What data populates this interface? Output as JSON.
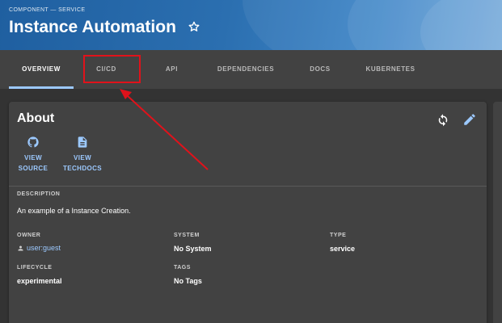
{
  "header": {
    "subtitle": "COMPONENT — SERVICE",
    "title": "Instance Automation"
  },
  "tabs": [
    {
      "label": "OVERVIEW",
      "active": true
    },
    {
      "label": "CI/CD",
      "active": false
    },
    {
      "label": "API",
      "active": false
    },
    {
      "label": "DEPENDENCIES",
      "active": false
    },
    {
      "label": "DOCS",
      "active": false
    },
    {
      "label": "KUBERNETES",
      "active": false
    }
  ],
  "about": {
    "title": "About",
    "links": [
      {
        "line1": "VIEW",
        "line2": "SOURCE",
        "icon": "github-icon"
      },
      {
        "line1": "VIEW",
        "line2": "TECHDOCS",
        "icon": "document-icon"
      }
    ],
    "description_label": "DESCRIPTION",
    "description": "An example of a Instance Creation.",
    "owner_label": "OWNER",
    "owner": "user:guest",
    "system_label": "SYSTEM",
    "system": "No System",
    "type_label": "TYPE",
    "type": "service",
    "lifecycle_label": "LIFECYCLE",
    "lifecycle": "experimental",
    "tags_label": "TAGS",
    "tags": "No Tags"
  },
  "colors": {
    "accent": "#9cc9ff",
    "highlight": "#e0121b",
    "header_blue": "#2b6fb0",
    "card_bg": "#424242",
    "page_bg": "#333333"
  }
}
